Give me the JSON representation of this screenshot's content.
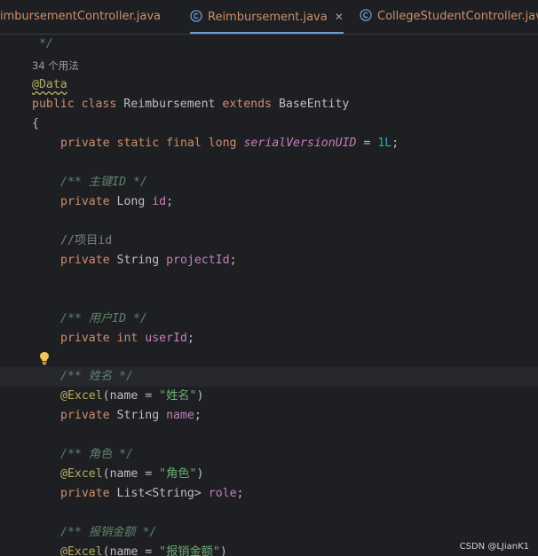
{
  "tabs": [
    {
      "label": "imbursementController.java",
      "active": false,
      "icon": "",
      "closable": false
    },
    {
      "label": "Reimbursement.java",
      "active": true,
      "icon": "java-class-icon",
      "closable": true
    },
    {
      "label": "CollegeStudentController.jav",
      "active": false,
      "icon": "java-class-icon",
      "closable": false
    }
  ],
  "editor": {
    "doc_end": " */",
    "usages_hint": "34 个用法",
    "annotation_data": "@Data",
    "class_decl": {
      "kw_public": "public",
      "kw_class": "class",
      "name": "Reimbursement",
      "kw_extends": "extends",
      "base": "BaseEntity"
    },
    "open_brace": "{",
    "serial": {
      "mods": "private static final long ",
      "name": "serialVersionUID",
      "eq": " = ",
      "value": "1L",
      "semi": ";"
    },
    "doc_id": "/** 主键ID */",
    "id_field": {
      "mods": "private ",
      "type": "Long ",
      "name": "id",
      "semi": ";"
    },
    "comment_project": "//项目id",
    "project_field": {
      "mods": "private ",
      "type": "String ",
      "name": "projectId",
      "semi": ";"
    },
    "doc_user": "/** 用户ID */",
    "user_field": {
      "mods": "private ",
      "type": "int ",
      "name": "userId",
      "semi": ";"
    },
    "doc_name": "/** 姓名 */",
    "excel_name": {
      "anno": "@Excel",
      "open": "(name = ",
      "value": "\"姓名\"",
      "close": ")"
    },
    "name_field": {
      "mods": "private ",
      "type": "String ",
      "name": "name",
      "semi": ";"
    },
    "doc_role": "/** 角色 */",
    "excel_role": {
      "anno": "@Excel",
      "open": "(name = ",
      "value": "\"角色\"",
      "close": ")"
    },
    "role_field": {
      "mods": "private ",
      "type": "List<String> ",
      "name": "role",
      "semi": ";"
    },
    "doc_amount": "/** 报销金额 */",
    "excel_amount": {
      "anno": "@Excel",
      "open": "(name = ",
      "value": "\"报销金额\"",
      "close": ")"
    }
  },
  "watermark": "CSDN @LJianK1",
  "colors": {
    "background": "#1e1f22",
    "keyword": "#cf8e6d",
    "field": "#c77dbb",
    "number": "#2aacb8",
    "string": "#6aab73",
    "annotation": "#b3ae60",
    "doc_comment": "#5f826b",
    "comment": "#7a7e85",
    "tab_underline": "#6b9bd8"
  }
}
